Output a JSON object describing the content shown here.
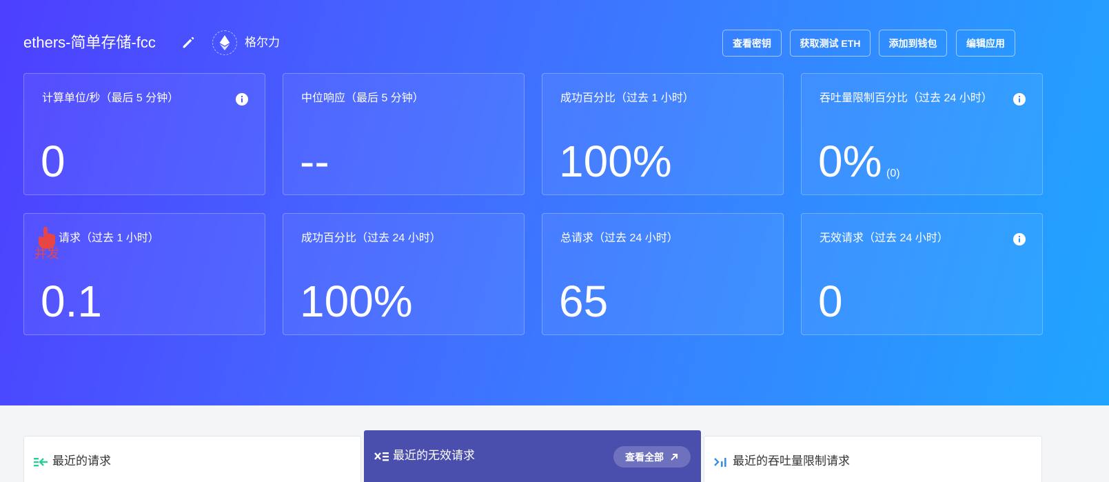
{
  "header": {
    "app_name": "ethers-简单存储-fcc",
    "network": "格尔力",
    "buttons": {
      "view_key": "查看密钥",
      "get_test_eth": "获取测试 ETH",
      "add_to_wallet": "添加到钱包",
      "edit_app": "编辑应用"
    }
  },
  "cards": [
    {
      "label": "计算单位/秒（最后 5 分钟）",
      "value": "0",
      "info": true
    },
    {
      "label": "中位响应（最后 5 分钟）",
      "value": "--",
      "info": false
    },
    {
      "label": "成功百分比（过去 1 小时）",
      "value": "100%",
      "info": false
    },
    {
      "label": "吞吐量限制百分比（过去 24 小时）",
      "value": "0%",
      "sub": "(0)",
      "info": true
    },
    {
      "label": "请求（过去 1 小时）",
      "value": "0.1",
      "info": false
    },
    {
      "label": "成功百分比（过去 24 小时）",
      "value": "100%",
      "info": false
    },
    {
      "label": "总请求（过去 24 小时）",
      "value": "65",
      "info": false
    },
    {
      "label": "无效请求（过去 24 小时）",
      "value": "0",
      "info": true
    }
  ],
  "overlay": {
    "cursor_text": "并发"
  },
  "panels": {
    "recent_requests": "最近的请求",
    "recent_invalid": "最近的无效请求",
    "view_all": "查看全部",
    "recent_throughput_limited": "最近的吞吐量限制请求"
  },
  "colors": {
    "hero_start": "#4d3fff",
    "hero_end": "#1fa5ff",
    "active_panel": "#4a4fae",
    "recent_icon": "#2ecc9a",
    "limit_icon": "#3a8fe0",
    "cursor_red": "#e84545"
  }
}
